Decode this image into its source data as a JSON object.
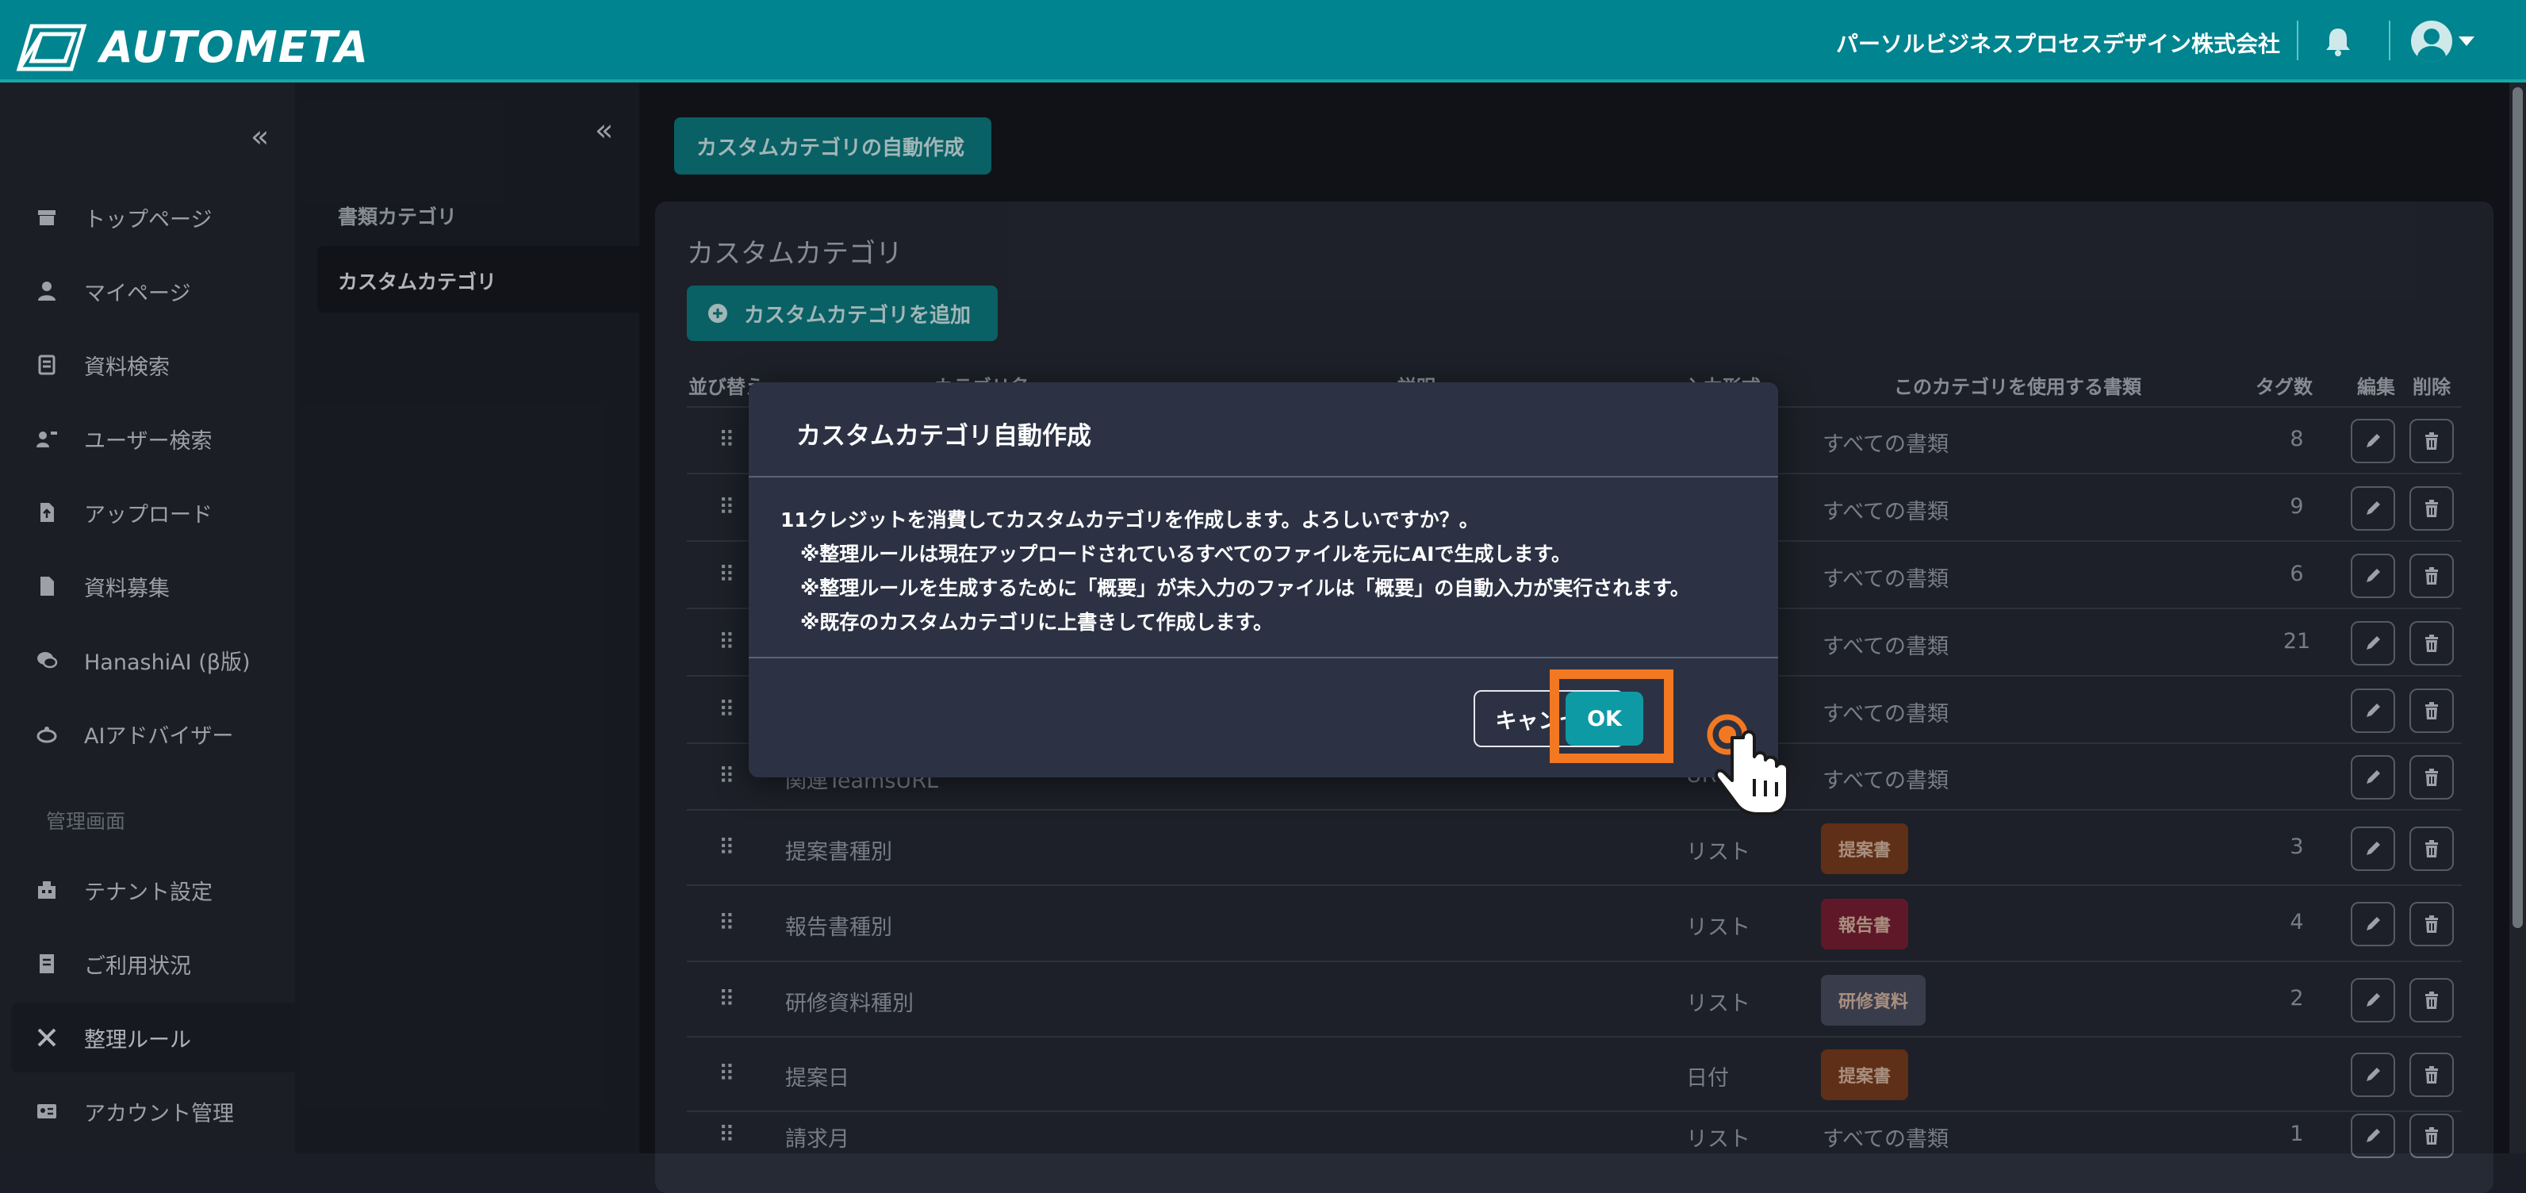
{
  "header": {
    "logo_text": "AUTOMETA",
    "company": "パーソルビジネスプロセスデザイン株式会社",
    "bell_icon": "bell-icon",
    "avatar_icon": "user-avatar-icon"
  },
  "sidebar": {
    "collapse": "«",
    "items": [
      {
        "label": "トップページ",
        "icon": "store-icon"
      },
      {
        "label": "マイページ",
        "icon": "person-icon"
      },
      {
        "label": "資料検索",
        "icon": "document-search-icon"
      },
      {
        "label": "ユーザー検索",
        "icon": "user-search-icon"
      },
      {
        "label": "アップロード",
        "icon": "file-upload-icon"
      },
      {
        "label": "資料募集",
        "icon": "file-icon"
      },
      {
        "label": "HanashiAI (β版)",
        "icon": "chat-icon"
      },
      {
        "label": "AIアドバイザー",
        "icon": "advisor-icon"
      }
    ],
    "admin_section": "管理画面",
    "admin_items": [
      {
        "label": "テナント設定",
        "icon": "building-icon"
      },
      {
        "label": "ご利用状況",
        "icon": "usage-icon"
      },
      {
        "label": "整理ルール",
        "icon": "tools-icon"
      },
      {
        "label": "アカウント管理",
        "icon": "id-card-icon"
      }
    ]
  },
  "subnav": {
    "collapse": "«",
    "items": [
      "書類カテゴリ",
      "カスタムカテゴリ"
    ]
  },
  "main": {
    "auto_create_button": "カスタムカテゴリの自動作成",
    "panel_title": "カスタムカテゴリ",
    "add_button": "カスタムカテゴリを追加",
    "columns": {
      "sort": "並び替え",
      "name": "カテゴリ名",
      "description": "説明",
      "input_type": "入力形式",
      "docs": "このカテゴリを使用する書類",
      "tag_count": "タグ数",
      "edit": "編集",
      "delete": "削除"
    },
    "rows": [
      {
        "name": "",
        "input": "",
        "docs": "すべての書類",
        "tag": "",
        "count": "8"
      },
      {
        "name": "",
        "input": "",
        "docs": "すべての書類",
        "tag": "",
        "count": "9"
      },
      {
        "name": "",
        "input": "",
        "docs": "すべての書類",
        "tag": "",
        "count": "6"
      },
      {
        "name": "",
        "input": "",
        "docs": "すべての書類",
        "tag": "",
        "count": "21"
      },
      {
        "name": "",
        "input": "",
        "docs": "すべての書類",
        "tag": "",
        "count": ""
      },
      {
        "name": "関連TeamsURL",
        "input": "URL",
        "docs": "すべての書類",
        "tag": "",
        "count": ""
      },
      {
        "name": "提案書種別",
        "input": "リスト",
        "docs": "",
        "tag": "提案書",
        "count": "3"
      },
      {
        "name": "報告書種別",
        "input": "リスト",
        "docs": "",
        "tag": "報告書",
        "count": "4"
      },
      {
        "name": "研修資料種別",
        "input": "リスト",
        "docs": "",
        "tag": "研修資料",
        "count": "2"
      },
      {
        "name": "提案日",
        "input": "日付",
        "docs": "",
        "tag": "提案書",
        "count": ""
      },
      {
        "name": "請求月",
        "input": "リスト",
        "docs": "すべての書類",
        "tag": "",
        "count": "1"
      }
    ],
    "tag_colors": {
      "提案書": "#7a3d1e",
      "報告書": "#7a1f34",
      "研修資料": "#4a4d60"
    }
  },
  "modal": {
    "title": "カスタムカテゴリ自動作成",
    "body": "11クレジットを消費してカスタムカテゴリを作成します。よろしいですか？。\n　※整理ルールは現在アップロードされているすべてのファイルを元にAIで生成します。\n　※整理ルールを生成するために「概要」が未入力のファイルは「概要」の自動入力が実行されます。\n　※既存のカスタムカテゴリに上書きして作成します。",
    "cancel": "キャンセル",
    "ok": "OK"
  },
  "colors": {
    "header": "#00848f",
    "accent": "#0e9aa5",
    "highlight": "#f27821"
  }
}
